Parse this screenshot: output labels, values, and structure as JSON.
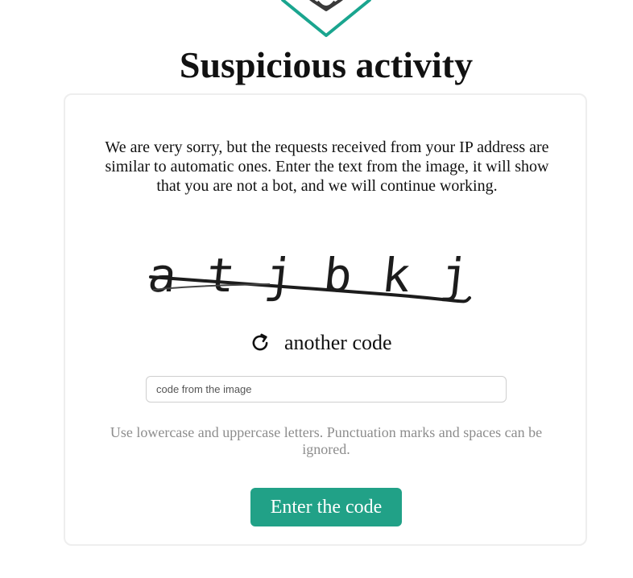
{
  "header": {
    "logo_icon": "shield-logo-icon",
    "title": "Suspicious activity"
  },
  "card": {
    "intro_text": "We are very sorry, but the requests received from your IP address are similar to automatic ones. Enter the text from the image, it will show that you are not a bot, and we will continue working.",
    "captcha_text": "atjbkj",
    "refresh": {
      "icon": "refresh-icon",
      "label": "another code"
    },
    "code_input": {
      "placeholder": "code from the image",
      "value": ""
    },
    "hint": "Use lowercase and uppercase letters. Punctuation marks and spaces can be ignored.",
    "submit_label": "Enter the code"
  },
  "colors": {
    "accent": "#21a187",
    "logo_stroke": "#1aa58f",
    "hint_text": "#8d8d8d",
    "card_border": "#eeeeee"
  }
}
